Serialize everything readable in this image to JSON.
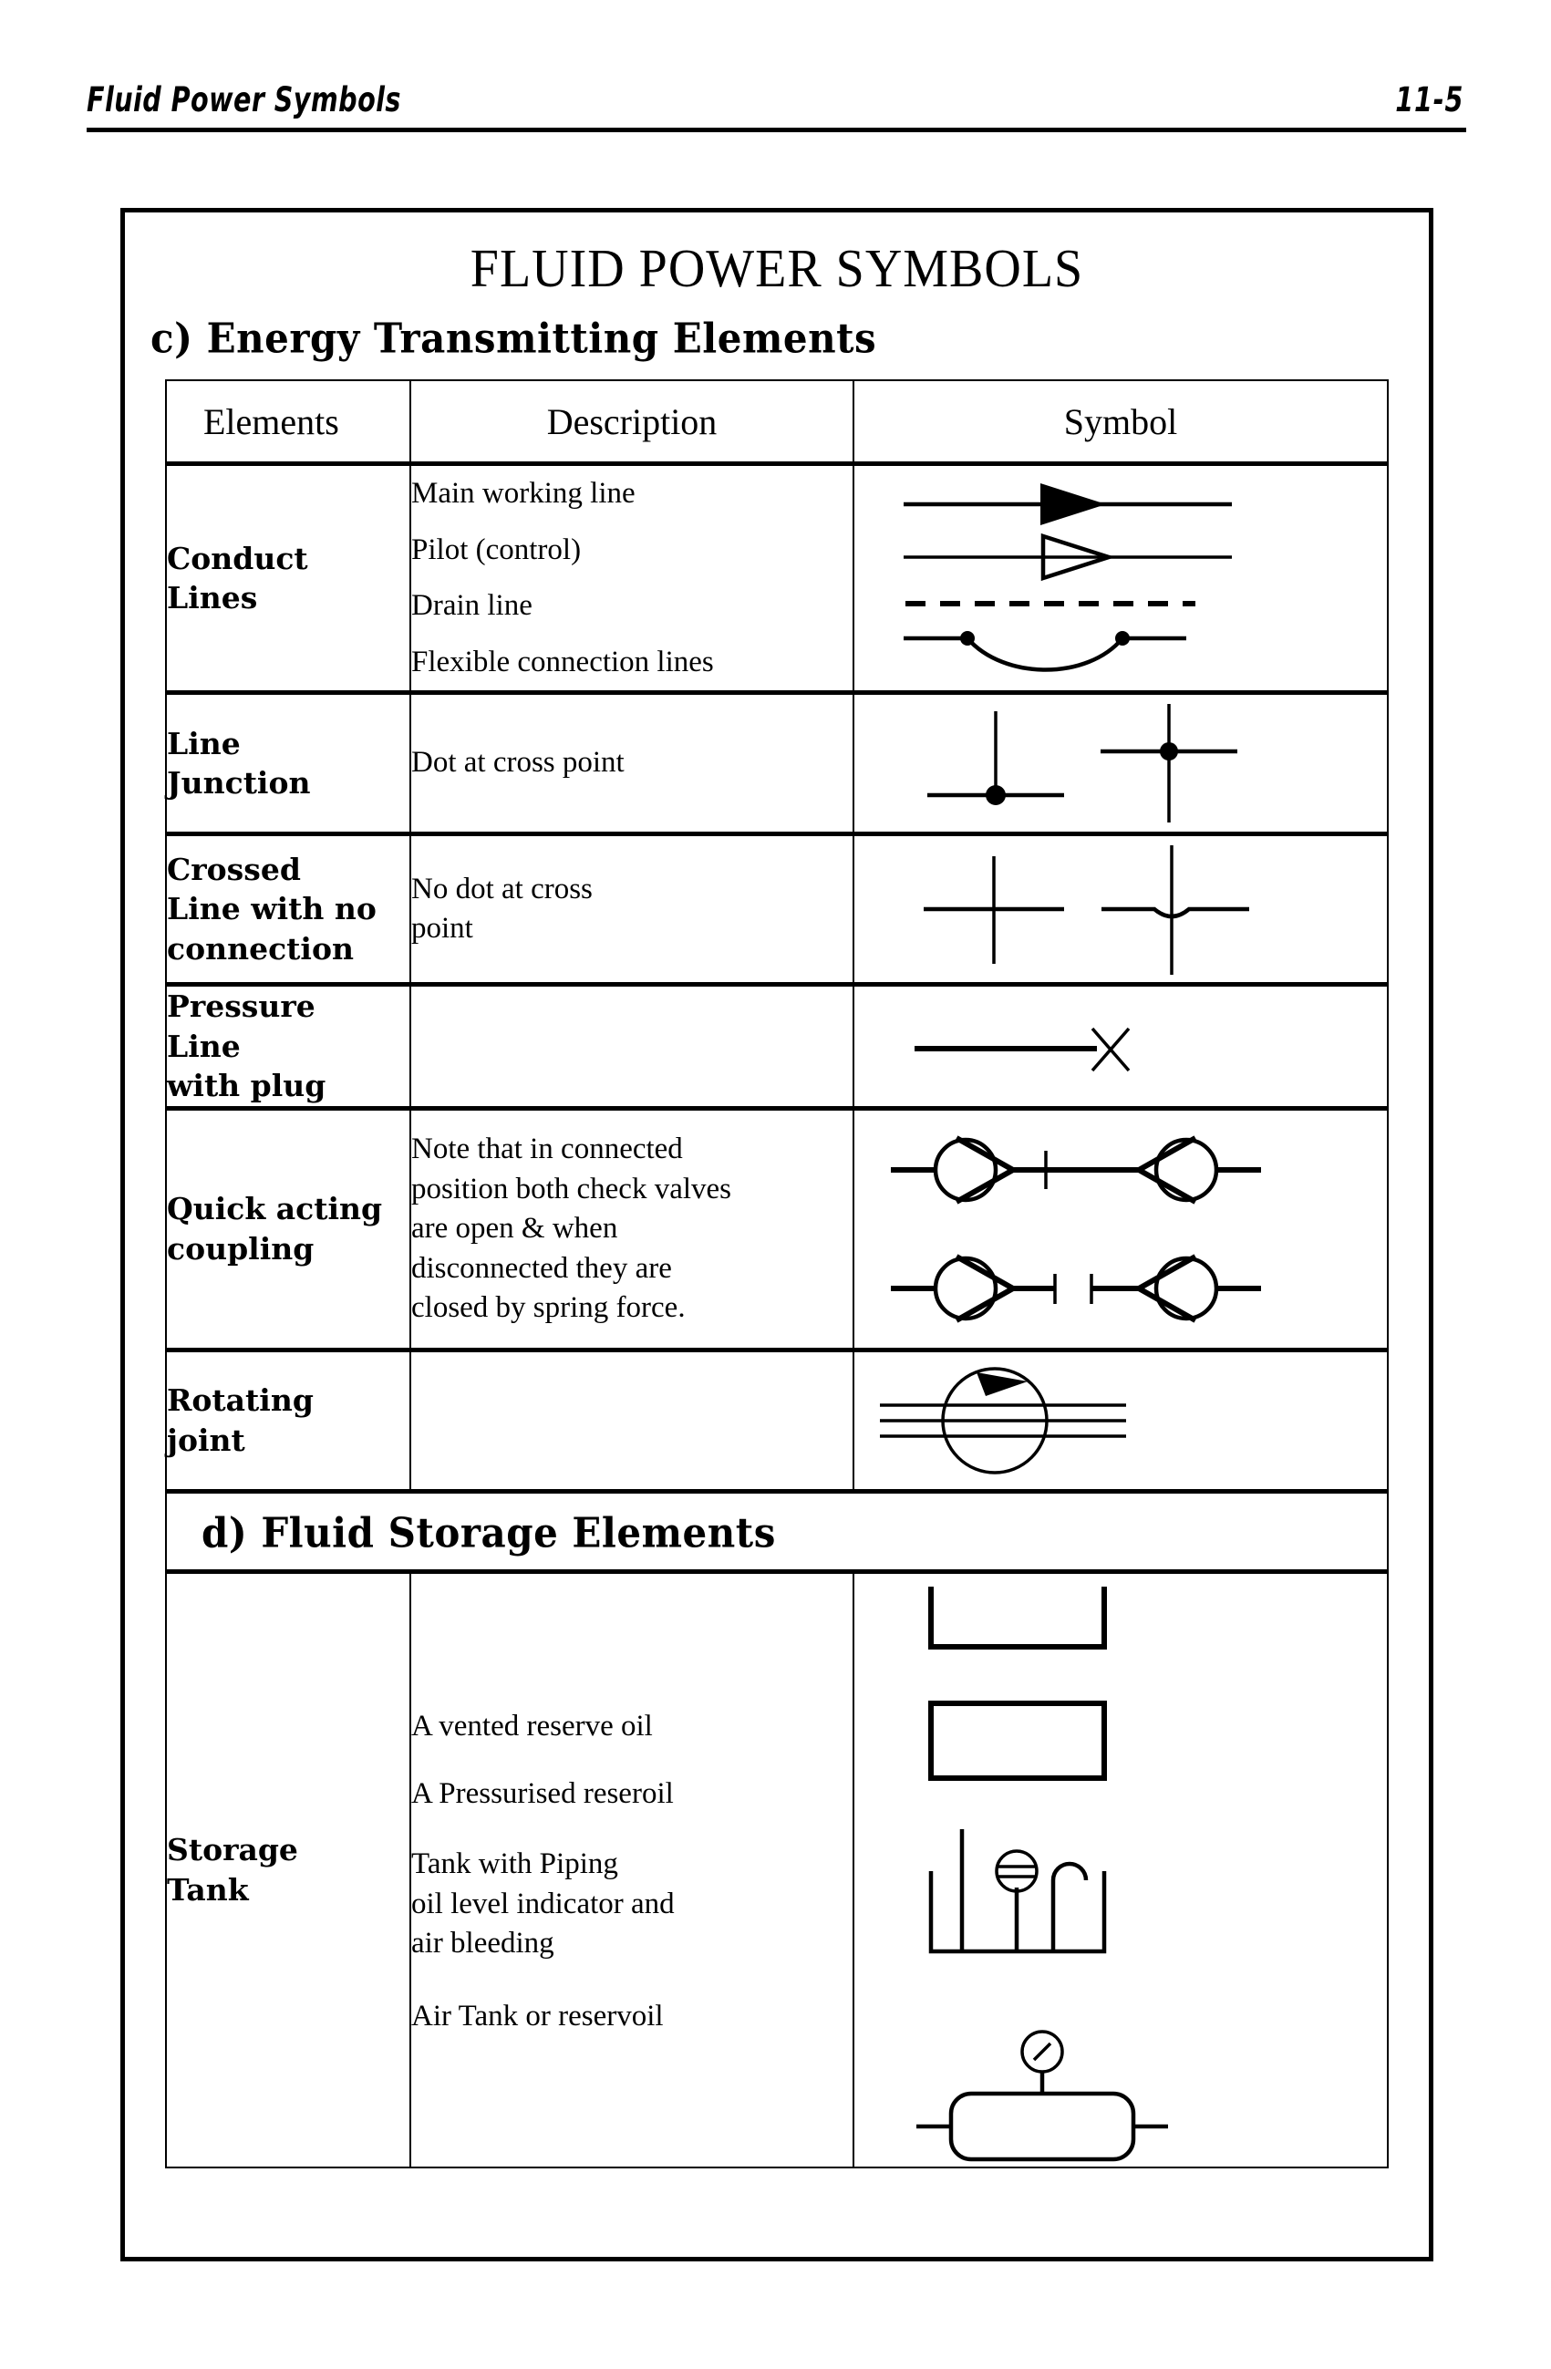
{
  "running_head": {
    "title": "Fluid Power Symbols",
    "page_number": "11-5"
  },
  "document": {
    "title": "FLUID POWER SYMBOLS",
    "sections": [
      {
        "id": "c",
        "heading": "c) Energy Transmitting  Elements"
      },
      {
        "id": "d",
        "heading": "d) Fluid Storage  Elements"
      }
    ],
    "table": {
      "columns": [
        "Elements",
        "Description",
        "Symbol"
      ],
      "rows": [
        {
          "element": "Conduct\nLines",
          "element_lines": [
            "Conduct",
            "Lines"
          ],
          "descriptions": [
            "Main working line",
            "Pilot (control)",
            "Drain line",
            "Flexible connection lines"
          ],
          "symbols": [
            "solid-arrow-line-icon",
            "hollow-arrow-line-icon",
            "dashed-line-icon",
            "flexible-connection-icon"
          ]
        },
        {
          "element_lines": [
            "Line",
            "Junction"
          ],
          "descriptions": [
            "Dot at cross point"
          ],
          "symbols": [
            "tee-junction-dot-icon",
            "cross-junction-dot-icon"
          ]
        },
        {
          "element_lines": [
            "Crossed",
            "Line with no",
            "connection"
          ],
          "descriptions": [
            "No dot at cross",
            "point"
          ],
          "symbols": [
            "plain-cross-icon",
            "line-hop-cross-icon"
          ]
        },
        {
          "element_lines": [
            "Pressure",
            "Line",
            "with plug"
          ],
          "descriptions": [],
          "symbols": [
            "plugged-line-icon"
          ]
        },
        {
          "element_lines": [
            "Quick acting",
            "coupling"
          ],
          "descriptions": [
            "Note that in connected",
            "position both check valves",
            "are open & when",
            "disconnected they are",
            "closed by spring force."
          ],
          "symbols": [
            "coupling-connected-icon",
            "coupling-disconnected-icon"
          ]
        },
        {
          "element_lines": [
            "Rotating",
            "joint"
          ],
          "descriptions": [],
          "symbols": [
            "rotating-joint-icon"
          ]
        },
        {
          "element_lines": [
            "Storage",
            "Tank"
          ],
          "descriptions": [
            "A vented reserve oil",
            "A Pressurised reseroil",
            "Tank with Piping",
            "oil level indicator and",
            "air bleeding",
            "Air Tank or reservoil"
          ],
          "symbols": [
            "vented-tank-icon",
            "pressurised-tank-icon",
            "tank-with-piping-icon",
            "air-tank-icon"
          ]
        }
      ]
    }
  },
  "colors": {
    "ink": "#000000",
    "paper": "#ffffff"
  }
}
